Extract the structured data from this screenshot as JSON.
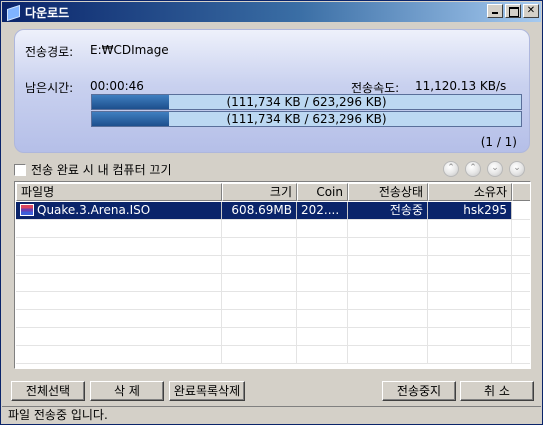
{
  "window": {
    "title": "다운로드",
    "accent": "#0a246a"
  },
  "panel": {
    "path_label": "전송경로:",
    "path_value": "E:₩CDImage",
    "remaining_label": "남은시간:",
    "remaining_value": "00:00:46",
    "speed_label": "전송속도:",
    "speed_value": "11,120.13 KB/s",
    "progress_text_1": "(111,734 KB / 623,296 KB)",
    "progress_text_2": "(111,734 KB / 623,296 KB)",
    "progress_fraction": 0.179,
    "count": "(1 / 1)"
  },
  "options": {
    "shutdown_label": "전송 완료 시 내 컴퓨터 끄기",
    "shutdown_checked": false
  },
  "nav_icons": [
    "top-icon",
    "up-icon",
    "down-icon",
    "bottom-icon"
  ],
  "table": {
    "columns": [
      "파일명",
      "크기",
      "Coin",
      "전송상태",
      "소유자"
    ],
    "rows": [
      {
        "name": "Quake.3.Arena.ISO",
        "size": "608.69MB",
        "coin": "202....",
        "status": "전송중",
        "owner": "hsk295"
      }
    ]
  },
  "buttons": {
    "select_all": "전체선택",
    "delete": "삭 제",
    "delete_completed": "완료목록삭제",
    "stop_transfer": "전송중지",
    "cancel": "취 소"
  },
  "statusbar": {
    "text": "파일 전송중 입니다."
  }
}
